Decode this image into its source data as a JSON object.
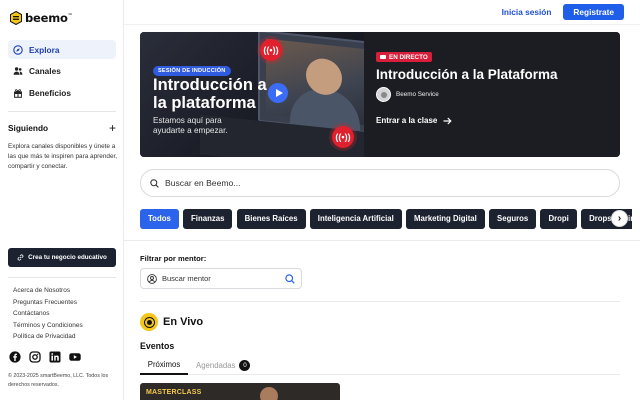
{
  "brand": {
    "name": "beemo",
    "trademark": "™"
  },
  "header": {
    "login_label": "Inicia sesión",
    "register_label": "Registrate"
  },
  "sidebar": {
    "nav": [
      {
        "label": "Explora",
        "icon": "compass-icon",
        "active": true
      },
      {
        "label": "Canales",
        "icon": "users-icon",
        "active": false
      },
      {
        "label": "Beneficios",
        "icon": "gift-icon",
        "active": false
      }
    ],
    "following_title": "Siguiendo",
    "following_desc": "Explora canales disponibles y únete a las que más te inspiren para aprender, compartir y conectar.",
    "create_label": "Crea tu negocio educativo",
    "links": [
      "Acerca de Nosotros",
      "Preguntas Frecuentes",
      "Contáctanos",
      "Términos y Condiciones",
      "Política de Privacidad"
    ],
    "socials": [
      "facebook-icon",
      "instagram-icon",
      "linkedin-icon",
      "youtube-icon"
    ],
    "copyright": "© 2023-2025 smartBeemo, LLC. Todos los derechos reservados."
  },
  "banner": {
    "session_tag": "SESIÓN DE INDUCCIÓN",
    "big_title": "Introducción a la plataforma",
    "subtitle": "Estamos aquí para ayudarte a empezar.",
    "live_label": "EN DIRECTO",
    "title": "Introducción a la Plataforma",
    "presenter": "Beemo Service",
    "cta": "Entrar a la clase"
  },
  "search": {
    "placeholder": "Buscar en Beemo..."
  },
  "categories": [
    "Todos",
    "Finanzas",
    "Bienes Raíces",
    "Inteligencia Artificial",
    "Marketing Digital",
    "Seguros",
    "Dropi",
    "Dropshipping"
  ],
  "mentor_filter": {
    "label": "Filtrar por mentor:",
    "placeholder": "Buscar mentor"
  },
  "live_section": {
    "title": "En Vivo",
    "events_title": "Eventos"
  },
  "tabs": [
    {
      "label": "Próximos",
      "active": true
    },
    {
      "label": "Agendadas",
      "count": "0",
      "active": false
    }
  ],
  "event_card": {
    "label": "MASTERCLASS"
  },
  "colors": {
    "accent": "#1e5ee8",
    "dark": "#1c2230",
    "live": "#d81e3a",
    "bee_yellow": "#f5c518"
  }
}
